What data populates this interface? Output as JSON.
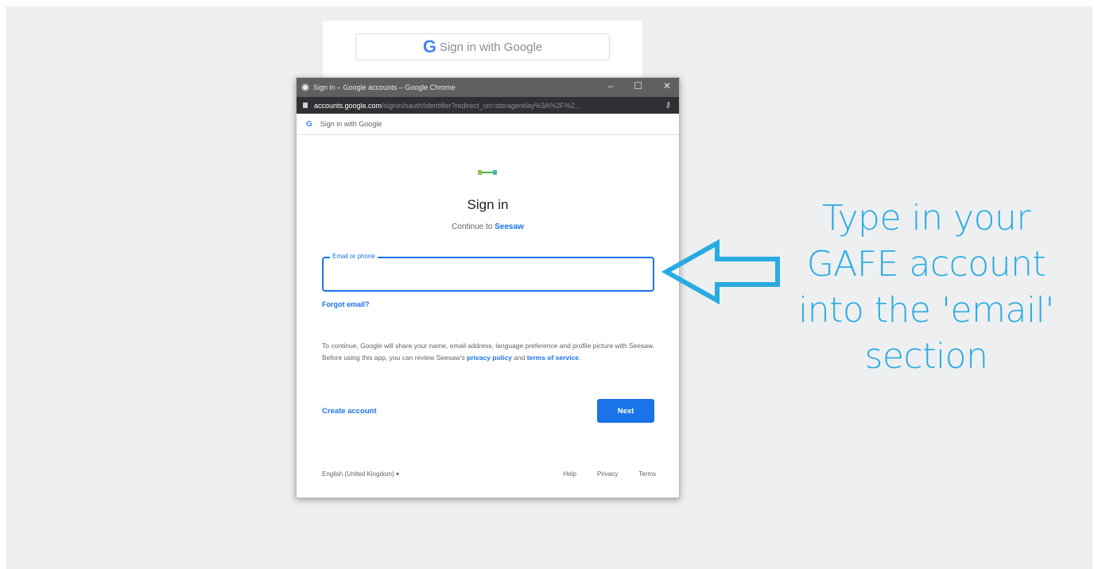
{
  "background_button": {
    "label": "Sign in with Google",
    "icon": "google-g-icon"
  },
  "popup": {
    "window_title": "Sign in – Google accounts – Google Chrome",
    "address_host": "accounts.google.com",
    "address_path": "/signin/oauth/identifier?redirect_uri=storagerelay%3A%2F%2...",
    "tab_label": "Sign in with Google",
    "heading": "Sign in",
    "subtitle_prefix": "Continue to",
    "subtitle_app": "Seesaw",
    "email_label": "Email or phone",
    "email_value": "",
    "forgot_email": "Forgot email?",
    "notice_text": "To continue, Google will share your name, email address, language preference and profile picture with Seesaw. Before using this app, you can review Seesaw's",
    "privacy_link": "privacy policy",
    "and_text": "and",
    "terms_link": "terms of service",
    "create_account": "Create account",
    "next_button": "Next",
    "language": "English (United Kingdom)",
    "footer_links": [
      "Help",
      "Privacy",
      "Terms"
    ]
  },
  "annotation": {
    "lines": [
      "Type in your",
      "GAFE account",
      "into the 'email'",
      "section"
    ],
    "color": "#29abe2"
  },
  "colors": {
    "google_blue": "#1a73e8",
    "stage_bg": "#eeeff1"
  }
}
